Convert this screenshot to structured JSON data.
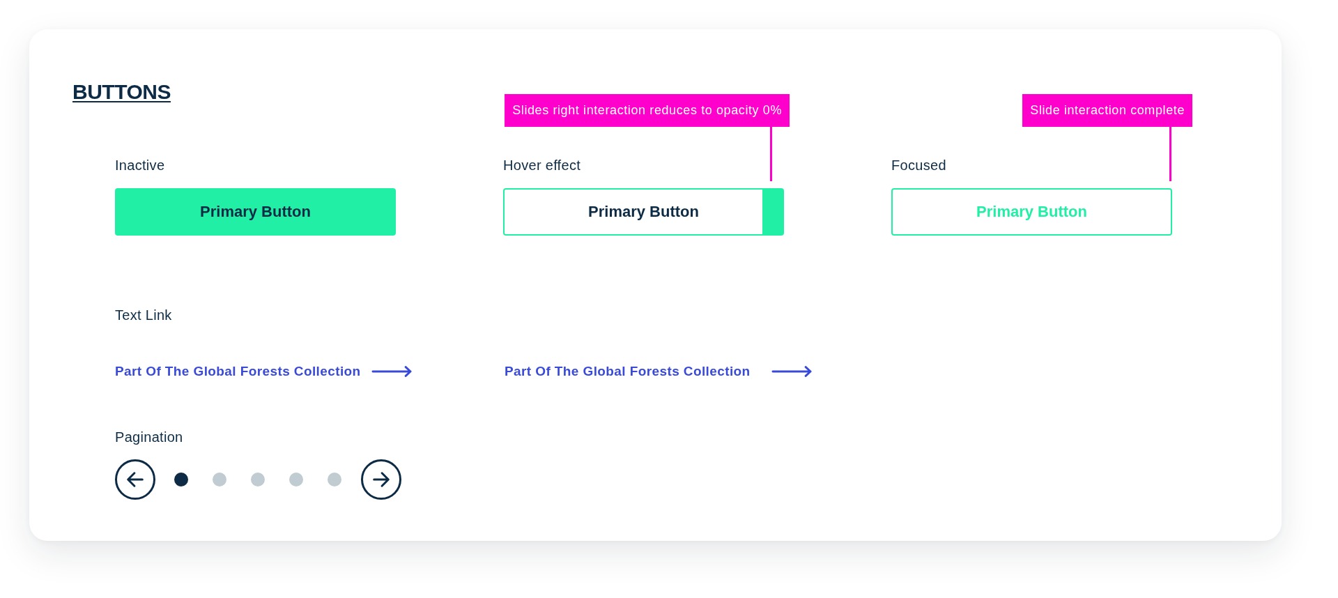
{
  "title": "BUTTONS",
  "button_states": [
    {
      "label": "Inactive",
      "button": "Primary Button",
      "kind": "filled"
    },
    {
      "label": "Hover effect",
      "button": "Primary Button",
      "kind": "hover",
      "annotation": "Slides right interaction reduces to opacity 0%"
    },
    {
      "label": "Focused",
      "button": "Primary Button",
      "kind": "focused",
      "annotation": "Slide interaction complete"
    }
  ],
  "text_link": {
    "label": "Text Link",
    "links": [
      {
        "text": "Part Of The Global Forests Collection",
        "kind": "default"
      },
      {
        "text": "Part Of The Global Forests Collection",
        "kind": "hover"
      }
    ]
  },
  "pagination": {
    "label": "Pagination",
    "dots": [
      {
        "selected": true
      },
      {
        "selected": false
      },
      {
        "selected": false
      },
      {
        "selected": false
      },
      {
        "selected": false
      }
    ]
  }
}
